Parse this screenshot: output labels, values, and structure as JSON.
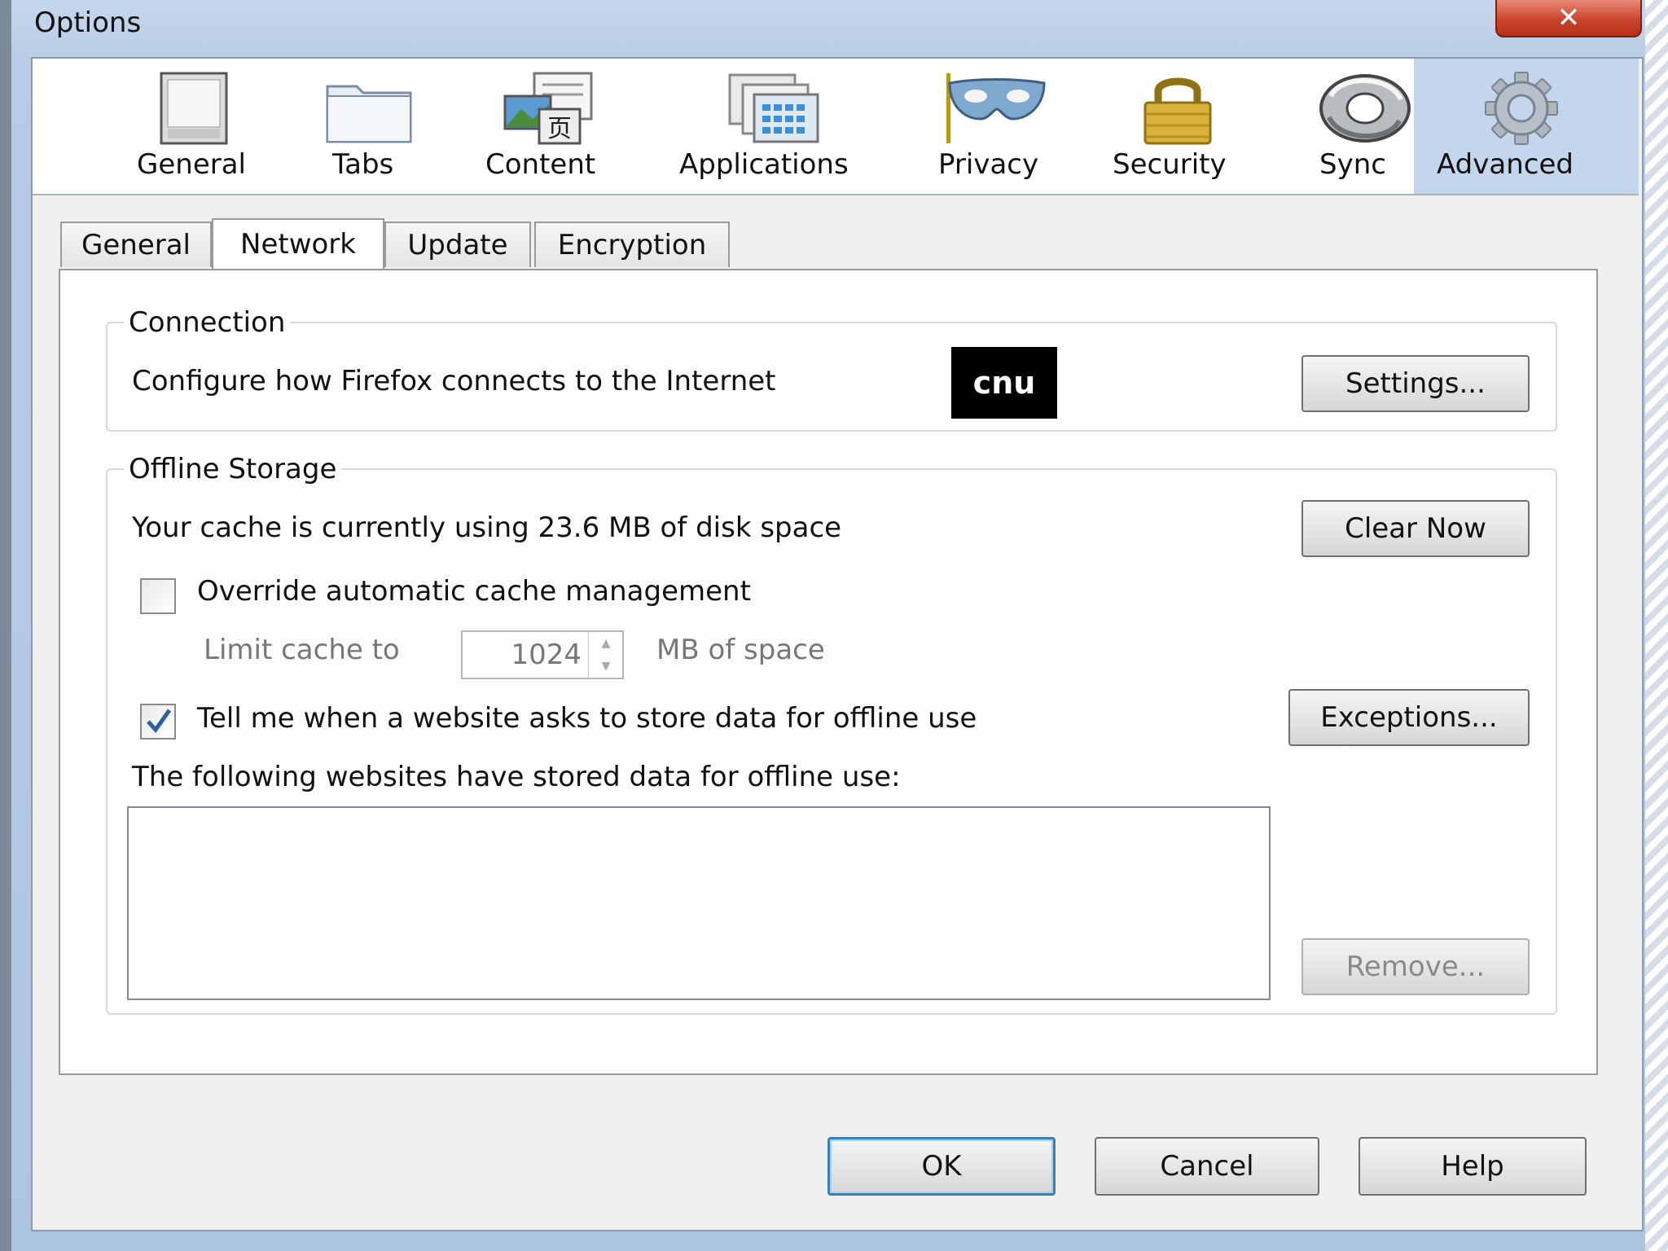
{
  "window": {
    "title": "Options",
    "close_glyph": "✕"
  },
  "toolbar": {
    "panes": [
      {
        "label": "General",
        "icon": "general-window-icon"
      },
      {
        "label": "Tabs",
        "icon": "tabs-folder-icon"
      },
      {
        "label": "Content",
        "icon": "content-page-icon"
      },
      {
        "label": "Applications",
        "icon": "applications-icon"
      },
      {
        "label": "Privacy",
        "icon": "privacy-mask-icon"
      },
      {
        "label": "Security",
        "icon": "security-padlock-icon"
      },
      {
        "label": "Sync",
        "icon": "sync-arrows-icon"
      },
      {
        "label": "Advanced",
        "icon": "advanced-gear-icon",
        "selected": true
      }
    ]
  },
  "tabs": [
    {
      "label": "General"
    },
    {
      "label": "Network",
      "active": true
    },
    {
      "label": "Update"
    },
    {
      "label": "Encryption"
    }
  ],
  "connection": {
    "legend": "Connection",
    "description": "Configure how Firefox connects to the Internet",
    "badge": "cnu",
    "settings_button": "Settings...",
    "settings_accesskey": "e"
  },
  "offline_storage": {
    "legend": "Offline Storage",
    "cache_usage": "Your cache is currently using 23.6 MB of disk space",
    "clear_button": "Clear Now",
    "override_label": "Override automatic cache management",
    "override_checked": false,
    "limit_label": "Limit cache to",
    "limit_value": "1024",
    "limit_unit": "MB of space",
    "notify_label": "Tell me when a website asks to store data for offline use",
    "notify_checked": true,
    "exceptions_button": "Exceptions...",
    "sites_label": "The following websites have stored data for offline use:",
    "remove_button": "Remove..."
  },
  "footer": {
    "ok": "OK",
    "cancel": "Cancel",
    "help": "Help"
  },
  "colors": {
    "accent": "#3c7fb1",
    "selected_pane": "#c3d6ec",
    "close": "#c9452d"
  }
}
